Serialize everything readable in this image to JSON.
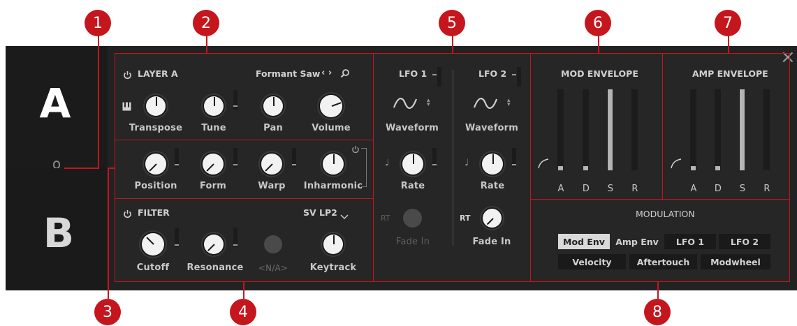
{
  "callouts": [
    "1",
    "2",
    "3",
    "4",
    "5",
    "6",
    "7",
    "8"
  ],
  "sidebar": {
    "layer_a": "A",
    "layer_b": "B"
  },
  "layer": {
    "title": "LAYER A",
    "preset": "Formant Saw",
    "knobs": [
      "Transpose",
      "Tune",
      "Pan",
      "Volume"
    ]
  },
  "wavetable": {
    "knobs": [
      "Position",
      "Form",
      "Warp",
      "Inharmonic"
    ]
  },
  "filter": {
    "title": "FILTER",
    "type": "SV LP2",
    "knobs": [
      "Cutoff",
      "Resonance",
      "<N/A>",
      "Keytrack"
    ]
  },
  "lfo": {
    "lfo1": {
      "title": "LFO 1",
      "waveform": "Waveform",
      "rate": "Rate",
      "rt": "RT",
      "fade_in": "Fade In"
    },
    "lfo2": {
      "title": "LFO 2",
      "waveform": "Waveform",
      "rate": "Rate",
      "rt": "RT",
      "fade_in": "Fade In"
    }
  },
  "mod_envelope": {
    "title": "MOD ENVELOPE",
    "stages": [
      "A",
      "D",
      "S",
      "R"
    ],
    "levels": [
      0.05,
      0.05,
      1.0,
      0.0
    ]
  },
  "amp_envelope": {
    "title": "AMP ENVELOPE",
    "stages": [
      "A",
      "D",
      "S",
      "R"
    ],
    "levels": [
      0.05,
      0.05,
      1.0,
      0.0
    ]
  },
  "modulation": {
    "title": "MODULATION",
    "row1": [
      "Mod Env",
      "Amp Env",
      "LFO 1",
      "LFO 2"
    ],
    "row2": [
      "Velocity",
      "Aftertouch",
      "Modwheel"
    ],
    "active": "Mod Env"
  },
  "close": "×",
  "colors": {
    "accent": "#c4161c",
    "panel": "#222222",
    "knob": "#f2f2f2"
  }
}
